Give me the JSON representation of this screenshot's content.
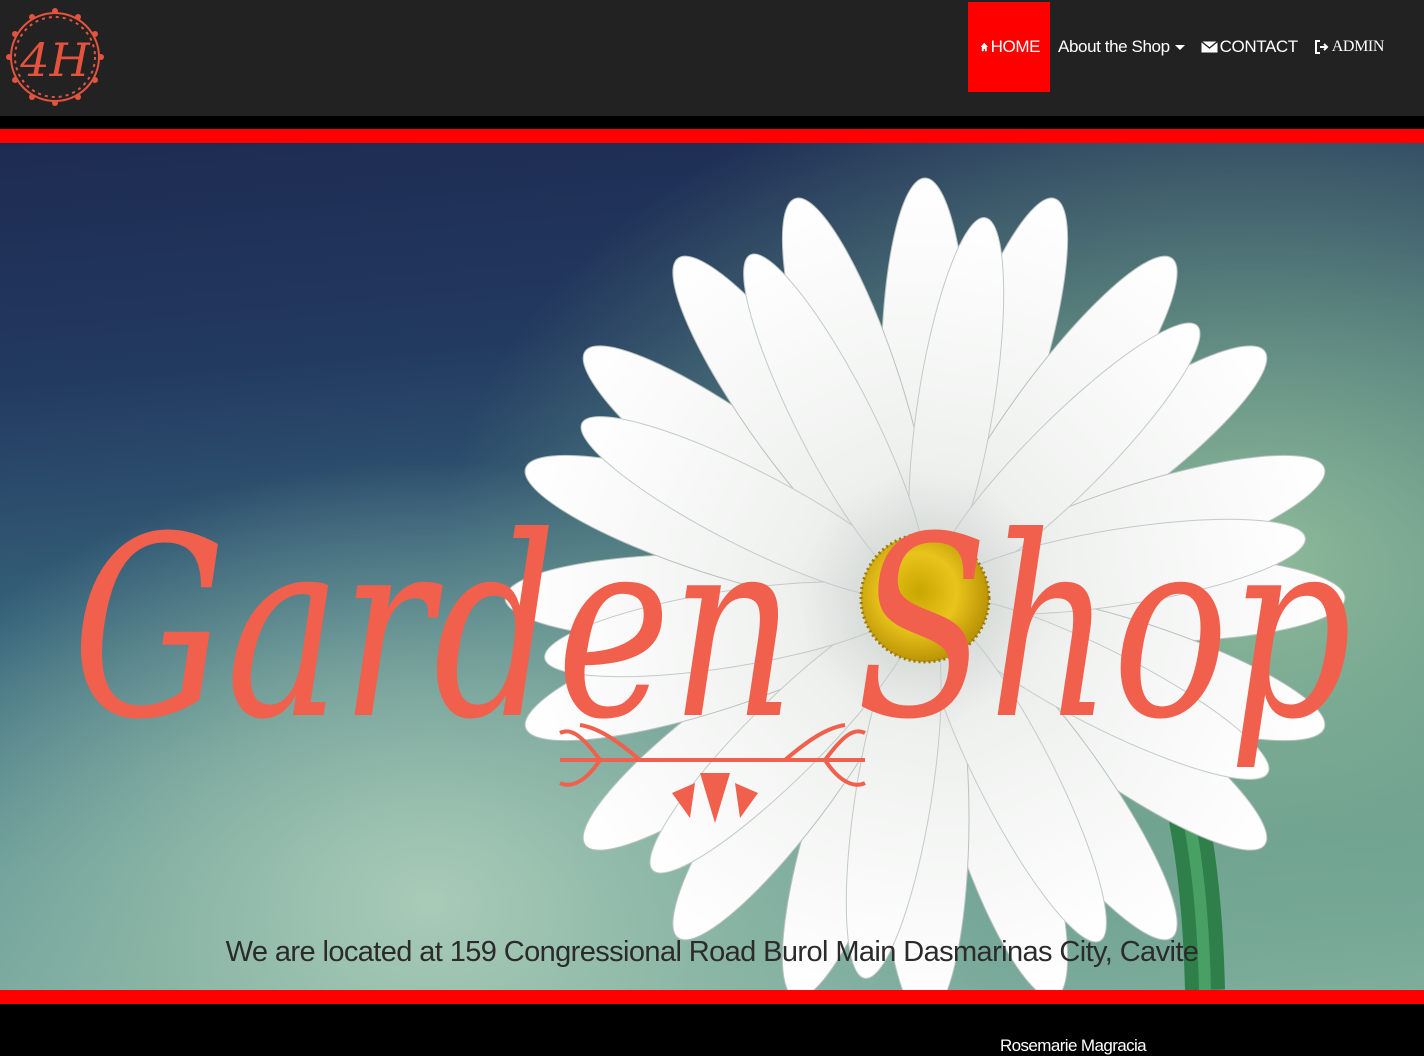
{
  "brand": {
    "logo_text": "4H"
  },
  "nav": {
    "home": "HOME",
    "about": "About the Shop",
    "contact": "CONTACT",
    "admin": "ADMIN"
  },
  "hero": {
    "title": "Garden Shop",
    "tagline": "We are located at 159 Congressional Road Burol Main Dasmarinas City, Cavite"
  },
  "footer": {
    "name": "Rosemarie Magracia"
  },
  "colors": {
    "accent": "#ff0000",
    "navbar": "#222222",
    "script_text": "#f0604d",
    "background": "#000000"
  }
}
